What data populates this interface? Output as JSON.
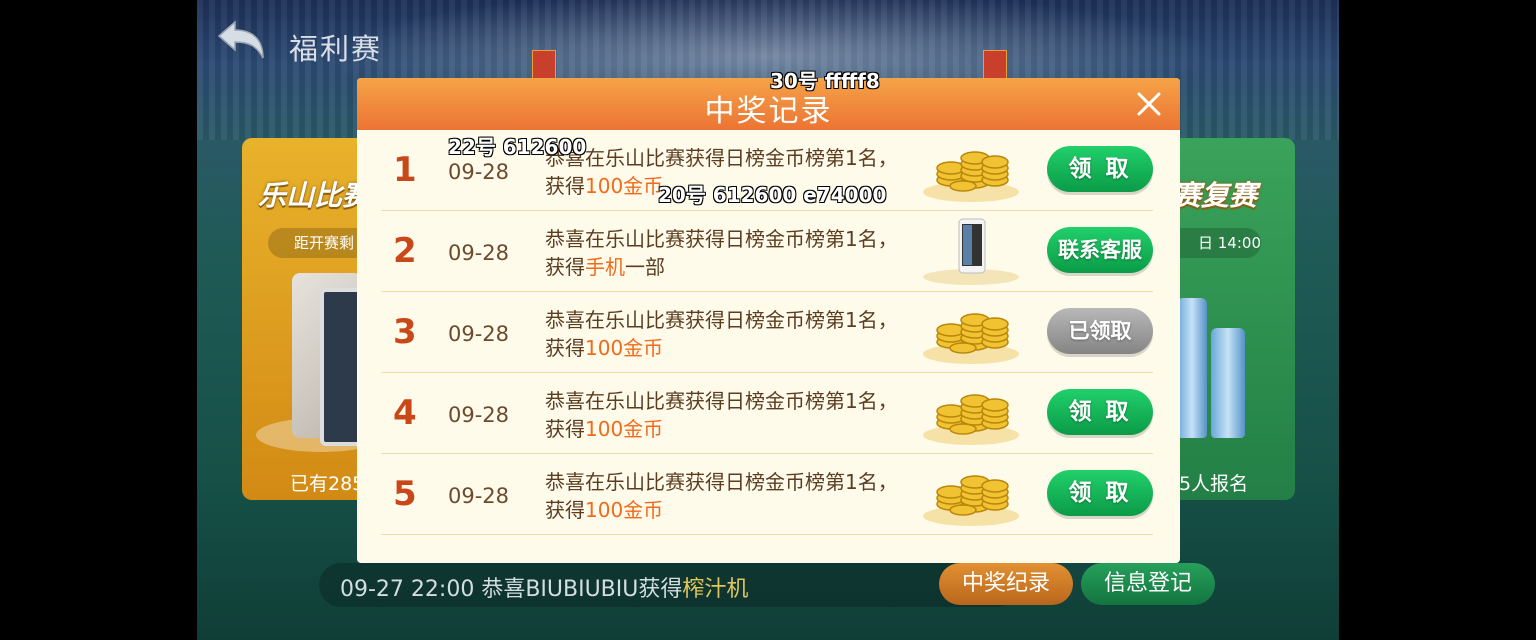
{
  "page": {
    "title": "福利赛"
  },
  "cards": {
    "left": {
      "title": "乐山比赛",
      "pill": "距开赛剩",
      "footer": "已有285"
    },
    "right": {
      "title": "赛复赛",
      "pill": "日 14:00",
      "footer": "5人报名"
    }
  },
  "ticker": {
    "prefix": "09-27 22:00 恭喜BIUBIUBIU获得",
    "item": "榨汁机"
  },
  "bottom_buttons": {
    "records": "中奖纪录",
    "info": "信息登记"
  },
  "modal": {
    "title": "中奖记录",
    "rows": [
      {
        "rank": "1",
        "date": "09-28",
        "line1": "恭喜在乐山比赛获得日榜金币榜第1名，",
        "line2_prefix": "获得",
        "prize": "100金币",
        "line2_suffix": "",
        "prize_icon": "gold-coins-icon",
        "action": "领 取",
        "action_state": "claim"
      },
      {
        "rank": "2",
        "date": "09-28",
        "line1": "恭喜在乐山比赛获得日榜金币榜第1名，",
        "line2_prefix": "获得",
        "prize": "手机",
        "line2_suffix": "一部",
        "prize_icon": "phone-icon",
        "action": "联系客服",
        "action_state": "contact"
      },
      {
        "rank": "3",
        "date": "09-28",
        "line1": "恭喜在乐山比赛获得日榜金币榜第1名，",
        "line2_prefix": "获得",
        "prize": "100金币",
        "line2_suffix": "",
        "prize_icon": "gold-coins-icon",
        "action": "已领取",
        "action_state": "claimed"
      },
      {
        "rank": "4",
        "date": "09-28",
        "line1": "恭喜在乐山比赛获得日榜金币榜第1名，",
        "line2_prefix": "获得",
        "prize": "100金币",
        "line2_suffix": "",
        "prize_icon": "gold-coins-icon",
        "action": "领 取",
        "action_state": "claim"
      },
      {
        "rank": "5",
        "date": "09-28",
        "line1": "恭喜在乐山比赛获得日榜金币榜第1名，",
        "line2_prefix": "获得",
        "prize": "100金币",
        "line2_suffix": "",
        "prize_icon": "gold-coins-icon",
        "action": "领 取",
        "action_state": "claim"
      }
    ]
  },
  "annotations": {
    "title_label": "30号 fffff8",
    "row_label": "22号 612600",
    "desc_label": "20号 612600 e74000"
  },
  "colors": {
    "header": "#ec7433",
    "modal_bg": "#fffbea",
    "rank": "#c9481a",
    "prize_text": "#f26a1b",
    "button_green": "#0b9b47",
    "button_gray": "#848484"
  }
}
